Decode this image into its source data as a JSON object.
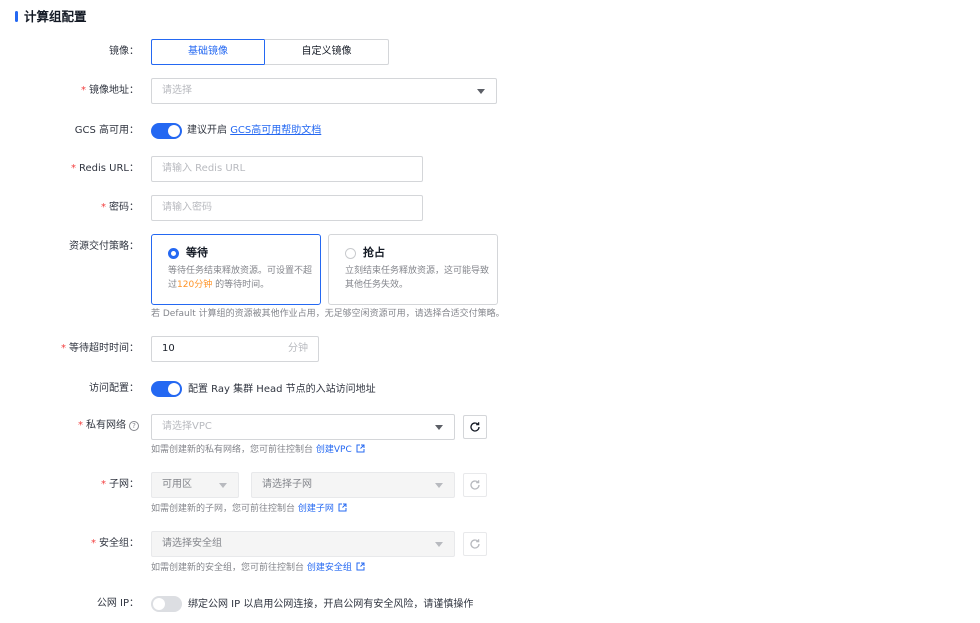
{
  "section": {
    "title": "计算组配置"
  },
  "image": {
    "label": "镜像：",
    "options": [
      "基础镜像",
      "自定义镜像"
    ],
    "selected": "基础镜像"
  },
  "image_address": {
    "label": "镜像地址：",
    "placeholder": "请选择"
  },
  "gcs": {
    "label": "GCS 高可用：",
    "enabled": true,
    "text": "建议开启",
    "link": "GCS高可用帮助文档"
  },
  "redis_url": {
    "label": "Redis URL：",
    "placeholder": "请输入 Redis URL"
  },
  "password": {
    "label": "密码：",
    "placeholder": "请输入密码"
  },
  "delivery": {
    "label": "资源交付策略：",
    "selected": "等待",
    "options": [
      {
        "title": "等待",
        "desc_1": "等待任务结束释放资源。可设置不超过",
        "highlight": "120分钟",
        "desc_2": " 的等待时间。"
      },
      {
        "title": "抢占",
        "desc": "立刻结束任务释放资源，这可能导致其他任务失效。"
      }
    ],
    "hint": "若 Default 计算组的资源被其他作业占用，无足够空闲资源可用，请选择合适交付策略。"
  },
  "timeout": {
    "label": "等待超时时间：",
    "value": "10",
    "unit": "分钟"
  },
  "access": {
    "label": "访问配置：",
    "enabled": true,
    "text": "配置 Ray 集群 Head 节点的入站访问地址"
  },
  "vpc": {
    "label": "私有网络",
    "help_icon": "?",
    "placeholder": "请选择VPC",
    "hint": "如需创建新的私有网络，您可前往控制台",
    "link": "创建VPC"
  },
  "subnet": {
    "label": "子网：",
    "zone_value": "可用区",
    "placeholder": "请选择子网",
    "hint": "如需创建新的子网，您可前往控制台",
    "link": "创建子网"
  },
  "security_group": {
    "label": "安全组：",
    "placeholder": "请选择安全组",
    "hint": "如需创建新的安全组，您可前往控制台",
    "link": "创建安全组"
  },
  "public_ip": {
    "label": "公网 IP：",
    "enabled": false,
    "text": "绑定公网 IP 以启用公网连接，开启公网有安全风险，请谨慎操作"
  },
  "colors": {
    "primary": "#2468f2",
    "required": "#f33e3e",
    "highlight": "#ff9326"
  }
}
